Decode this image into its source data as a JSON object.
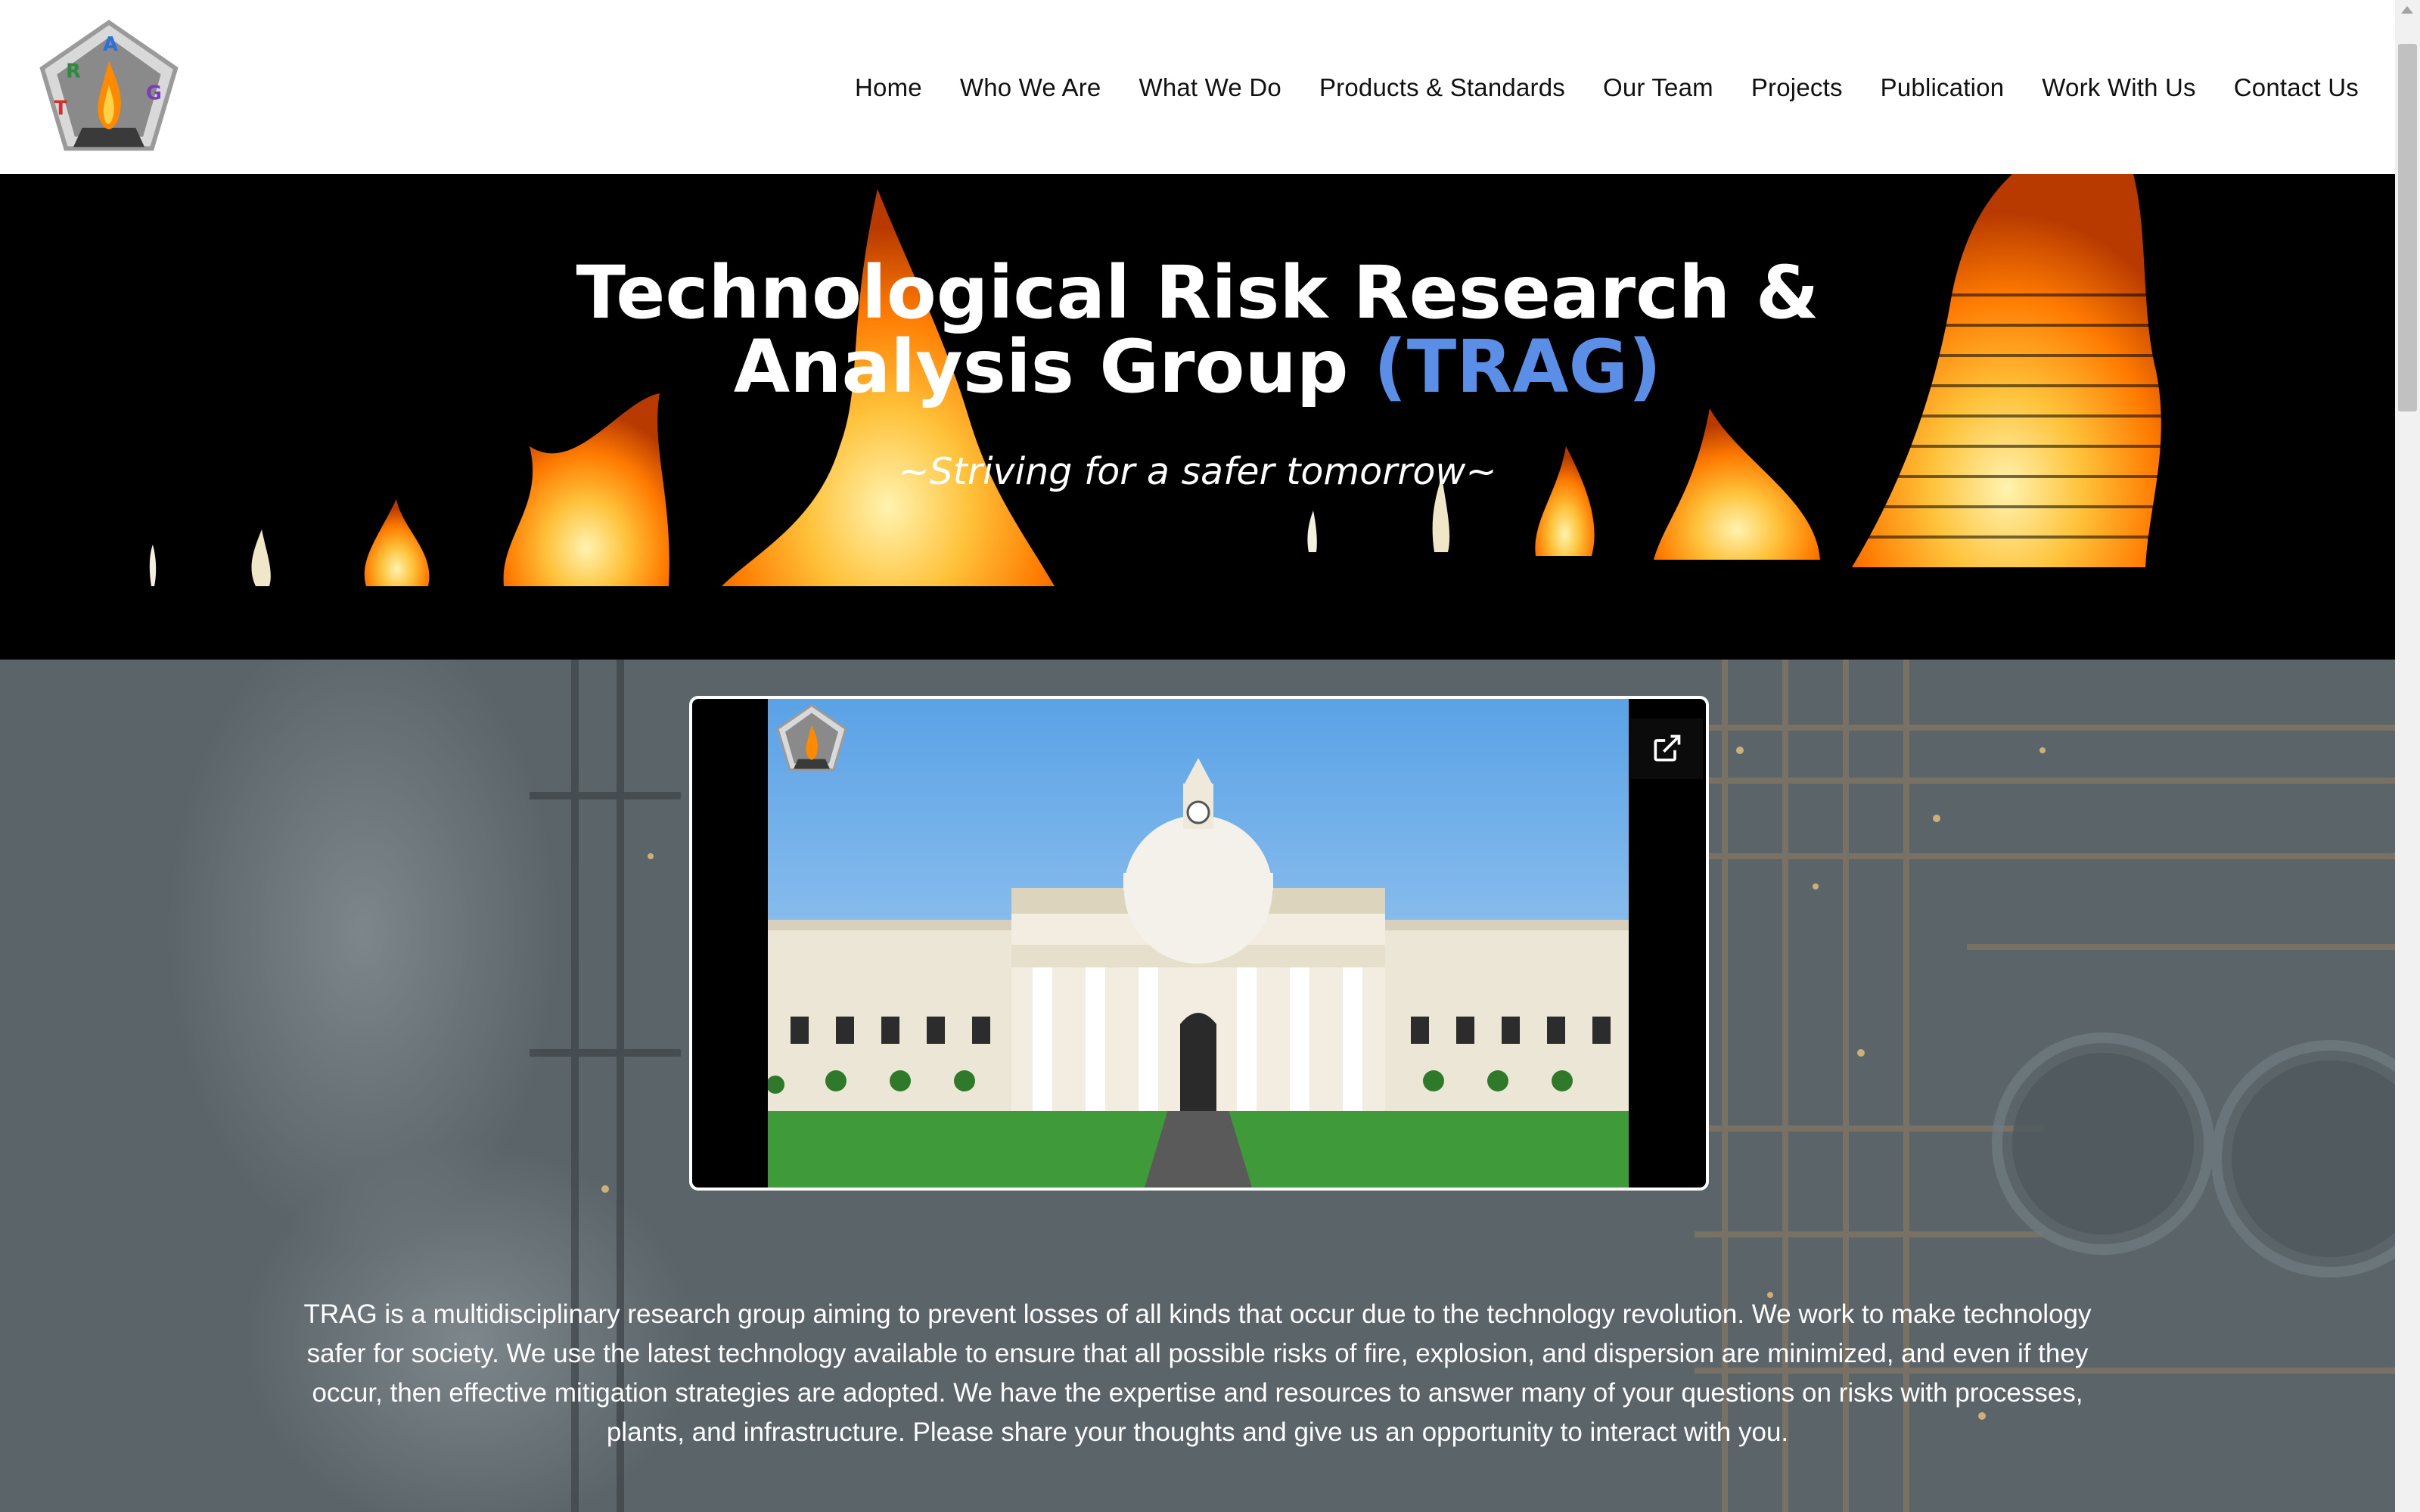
{
  "header": {
    "logo": {
      "name": "trag-logo",
      "letters": [
        "T",
        "R",
        "A",
        "G"
      ]
    },
    "nav": [
      {
        "label": "Home"
      },
      {
        "label": "Who We Are"
      },
      {
        "label": "What We Do"
      },
      {
        "label": "Products & Standards"
      },
      {
        "label": "Our Team"
      },
      {
        "label": "Projects"
      },
      {
        "label": "Publication"
      },
      {
        "label": "Work With Us"
      },
      {
        "label": "Contact Us"
      }
    ]
  },
  "hero": {
    "title_line1": "Technological Risk Research &",
    "title_line2": "Analysis Group ",
    "title_accent": "(TRAG)",
    "tagline": "~Striving for a safer tomorrow~"
  },
  "media": {
    "external_link_icon": "external-link-icon"
  },
  "intro": {
    "text": "TRAG is a multidisciplinary research group aiming to prevent losses of all kinds that occur due to the technology revolution. We work to make technology safer for society. We use the latest technology available to ensure that all possible risks of fire, explosion, and dispersion are minimized, and even if they occur, then effective mitigation strategies are adopted. We have the expertise and resources to answer many of your questions on risks with processes, plants, and infrastructure. Please share your thoughts and give us an opportunity to interact with you."
  },
  "colors": {
    "accent": "#5b8ee6",
    "hero_bg": "#000000",
    "content_bg": "#556065",
    "flame_orange": "#ff8a00",
    "flame_yellow": "#ffd24a"
  }
}
